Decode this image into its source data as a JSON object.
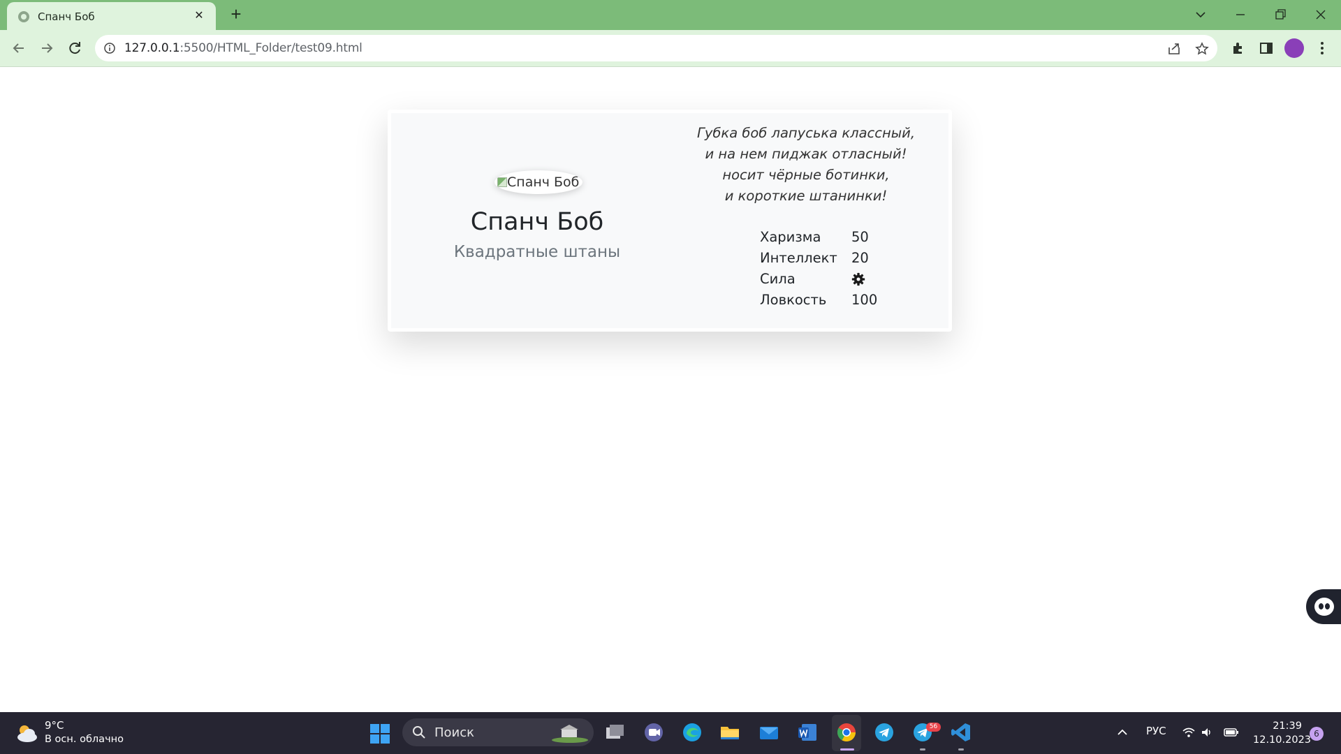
{
  "browser": {
    "tab_title": "Спанч Боб",
    "url_host": "127.0.0.1",
    "url_path": ":5500/HTML_Folder/test09.html"
  },
  "card": {
    "image_alt": "Спанч Боб",
    "name": "Спанч Боб",
    "subtitle": "Квадратные штаны",
    "poem": [
      "Губка боб лапуська классный,",
      "и на нем пиджак отласный!",
      "носит чёрные ботинки,",
      "и короткие штанинки!"
    ],
    "stats": [
      {
        "label": "Харизма",
        "value": "50"
      },
      {
        "label": "Интеллект",
        "value": "20"
      },
      {
        "label": "Сила",
        "value": "",
        "icon": "gear-icon"
      },
      {
        "label": "Ловкость",
        "value": "100"
      }
    ]
  },
  "taskbar": {
    "temperature": "9°C",
    "weather": "В осн. облачно",
    "search_placeholder": "Поиск",
    "telegram_badge": "56",
    "language": "РУС",
    "time": "21:39",
    "date": "12.10.2023",
    "notifications": "6"
  },
  "colors": {
    "tabbar": "#7cbb79",
    "toolbar": "#dff3dd",
    "card_bg": "#f8f9fa",
    "taskbar": "#262532"
  }
}
